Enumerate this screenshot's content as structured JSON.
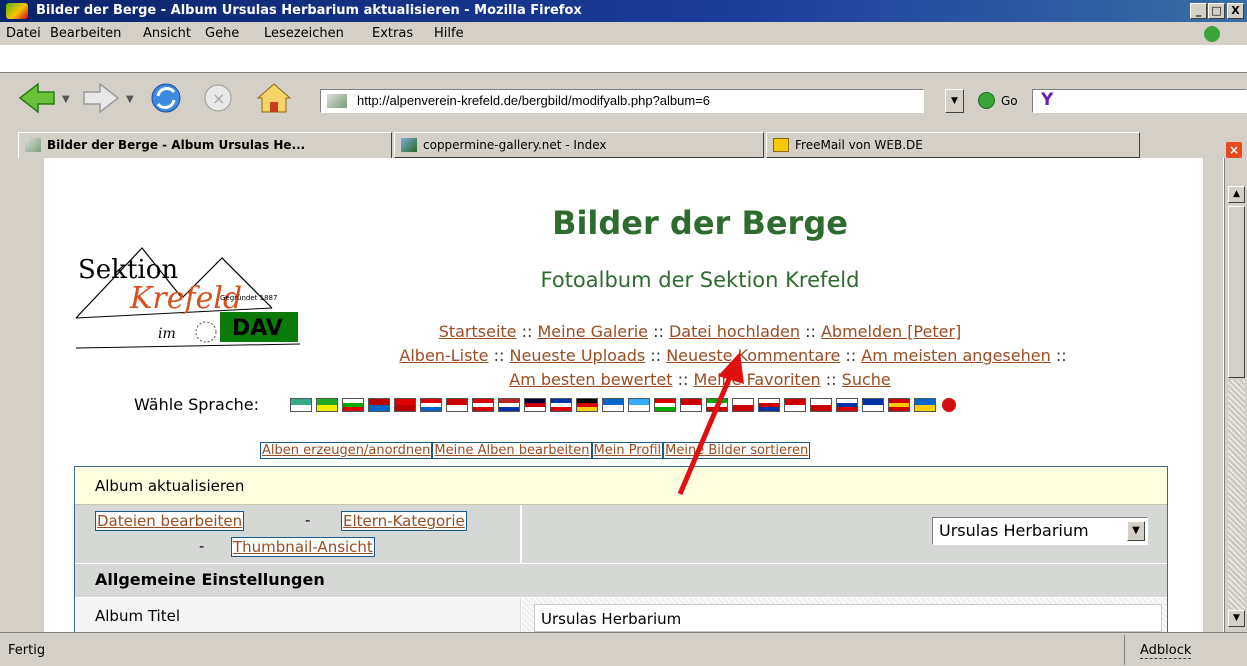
{
  "window": {
    "title": "Bilder der Berge - Album Ursulas Herbarium aktualisieren - Mozilla Firefox",
    "btn_min": "_",
    "btn_max": "□",
    "btn_close": "X"
  },
  "menu": [
    "Datei",
    "Bearbeiten",
    "Ansicht",
    "Gehe",
    "Lesezeichen",
    "Extras",
    "Hilfe"
  ],
  "nav": {
    "url": "http://alpenverein-krefeld.de/bergbild/modifyalb.php?album=6",
    "go_label": "Go",
    "search_value": "Y",
    "dropdown_arrow": "▼"
  },
  "tabs": [
    {
      "label": "Bilder der Berge - Album Ursulas He...",
      "active": true
    },
    {
      "label": "coppermine-gallery.net - Index",
      "active": false
    },
    {
      "label": "FreeMail von WEB.DE",
      "active": false
    }
  ],
  "page": {
    "logo": {
      "line1": "Sektion",
      "line2": "Krefeld",
      "line3": "im",
      "line4": "DAV",
      "small": "Gegründet 1887"
    },
    "title": "Bilder der Berge",
    "subtitle": "Fotoalbum der Sektion Krefeld",
    "nav_links_row1": [
      "Startseite",
      "Meine Galerie",
      "Datei hochladen",
      "Abmelden [Peter]"
    ],
    "nav_links_row2": [
      "Alben-Liste",
      "Neueste Uploads",
      "Neueste Kommentare",
      "Am meisten angesehen"
    ],
    "nav_links_row3": [
      "Am besten bewertet",
      "Meine Favoriten",
      "Suche"
    ],
    "separator": "::",
    "language_label": "Wähle Sprache:",
    "admin_buttons": [
      "Alben erzeugen/anordnen",
      "Meine Alben bearbeiten",
      "Mein Profil",
      "Meine Bilder sortieren"
    ],
    "form": {
      "header": "Album aktualisieren",
      "links": [
        "Dateien bearbeiten",
        "Eltern-Kategorie",
        "Thumbnail-Ansicht"
      ],
      "link_sep": "-",
      "album_select": "Ursulas Herbarium",
      "section": "Allgemeine Einstellungen",
      "title_label": "Album Titel",
      "title_value": "Ursulas Herbarium"
    }
  },
  "status": {
    "text": "Fertig",
    "adblock": "Adblock"
  },
  "colors": {
    "heading": "#2e6b2e",
    "link": "#9a4d21",
    "titlebar": "#0a246a",
    "chrome": "#d4d0c8",
    "arrow": "#e01010",
    "form_header": "#ffffe0",
    "form_row": "#d5d8d5"
  }
}
